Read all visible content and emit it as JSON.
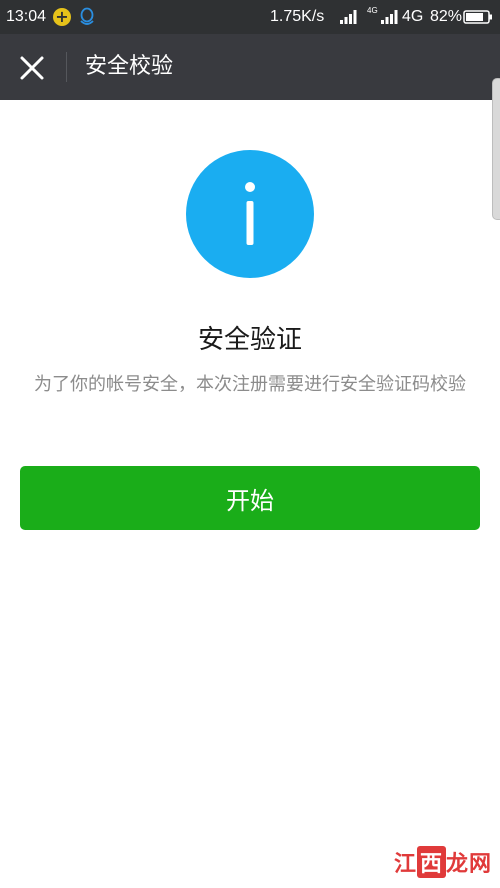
{
  "status_bar": {
    "time": "13:04",
    "net_speed": "1.75K/s",
    "net_small": "4G",
    "net_type": "4G",
    "battery": "82%"
  },
  "header": {
    "title": "安全校验",
    "close_icon": "close-icon"
  },
  "main": {
    "icon": "info-icon",
    "icon_color": "#1aadf1",
    "heading": "安全验证",
    "description": "为了你的帐号安全，本次注册需要进行安全验证码校验",
    "start_button_label": "开始",
    "button_color": "#1aad19"
  },
  "watermark": {
    "part1": "江",
    "part2": "西",
    "part3": "龙网"
  }
}
